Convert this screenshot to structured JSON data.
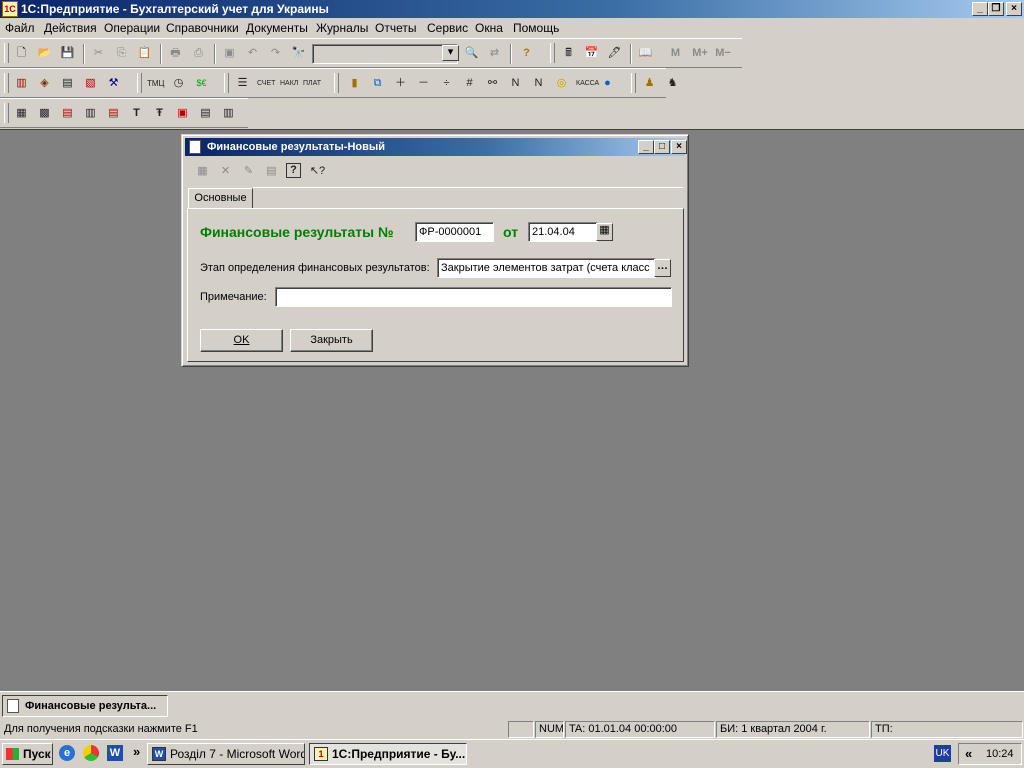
{
  "window": {
    "title": "1С:Предприятие - Бухгалтерский учет для Украины"
  },
  "menu": [
    "Файл",
    "Действия",
    "Операции",
    "Справочники",
    "Документы",
    "Журналы",
    "Отчеты",
    "Сервис",
    "Окна",
    "Помощь"
  ],
  "toolbar": {
    "memory_buttons": [
      "M",
      "M+",
      "M−"
    ]
  },
  "dialog": {
    "title": "Финансовые результаты-Новый",
    "tab": "Основные",
    "heading": "Финансовые результаты №",
    "number": "ФР-0000001",
    "date_label": "от",
    "date": "21.04.04",
    "stage_label": "Этап определения финансовых результатов:",
    "stage_value": "Закрытие элементов затрат (счета класс",
    "note_label": "Примечание:",
    "note_value": "",
    "ok_label": "OK",
    "close_label": "Закрыть"
  },
  "mdi_taskbar": {
    "item": "Финансовые результа..."
  },
  "status": {
    "hint": "Для получения подсказки нажмите F1",
    "num": "NUM",
    "ta": "TA: 01.01.04  00:00:00",
    "bi": "БИ: 1 квартал 2004 г.",
    "tp": "ТП:"
  },
  "taskbar": {
    "start": "Пуск",
    "more": "»",
    "tasks": [
      "Розділ 7 - Microsoft Word",
      "1С:Предприятие - Бу..."
    ],
    "lang": "UK",
    "chevron": "«",
    "clock": "10:24"
  },
  "icons": [
    "app-1c-icon",
    "new-doc-icon",
    "open-folder-icon",
    "save-icon",
    "cut-icon",
    "copy-icon",
    "paste-icon",
    "print-icon",
    "preview-icon",
    "find-icon",
    "help-icon",
    "calculator-icon",
    "calendar-icon"
  ]
}
